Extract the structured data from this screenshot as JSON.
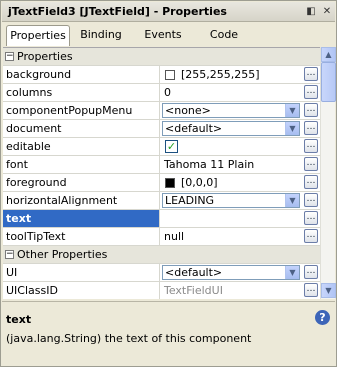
{
  "window": {
    "title": "jTextField3 [JTextField] - Properties",
    "icons": [
      "restore-icon",
      "close-icon"
    ]
  },
  "tabs": [
    "Properties",
    "Binding",
    "Events",
    "Code"
  ],
  "active_tab": "Properties",
  "categories": {
    "properties": "Properties",
    "other": "Other Properties"
  },
  "properties": {
    "background": {
      "name": "background",
      "value": "[255,255,255]",
      "swatch": "#ffffff"
    },
    "columns": {
      "name": "columns",
      "value": "0"
    },
    "componentPopupMenu": {
      "name": "componentPopupMenu",
      "value": "<none>"
    },
    "document": {
      "name": "document",
      "value": "<default>"
    },
    "editable": {
      "name": "editable",
      "checked": true
    },
    "font": {
      "name": "font",
      "value": "Tahoma 11 Plain"
    },
    "foreground": {
      "name": "foreground",
      "value": "[0,0,0]",
      "swatch": "#000000"
    },
    "horizontalAlignment": {
      "name": "horizontalAlignment",
      "value": "LEADING"
    },
    "text": {
      "name": "text",
      "value": ""
    },
    "toolTipText": {
      "name": "toolTipText",
      "value": "null"
    },
    "UI": {
      "name": "UI",
      "value": "<default>"
    },
    "UIClassID": {
      "name": "UIClassID",
      "value": "TextFieldUI"
    }
  },
  "selected_property": "text",
  "description": {
    "title": "text",
    "text": "(java.lang.String)  the text of this component"
  },
  "colors": {
    "selection": "#316ac5",
    "category_bg": "#e6e5db",
    "panel_bg": "#ece9d8"
  }
}
